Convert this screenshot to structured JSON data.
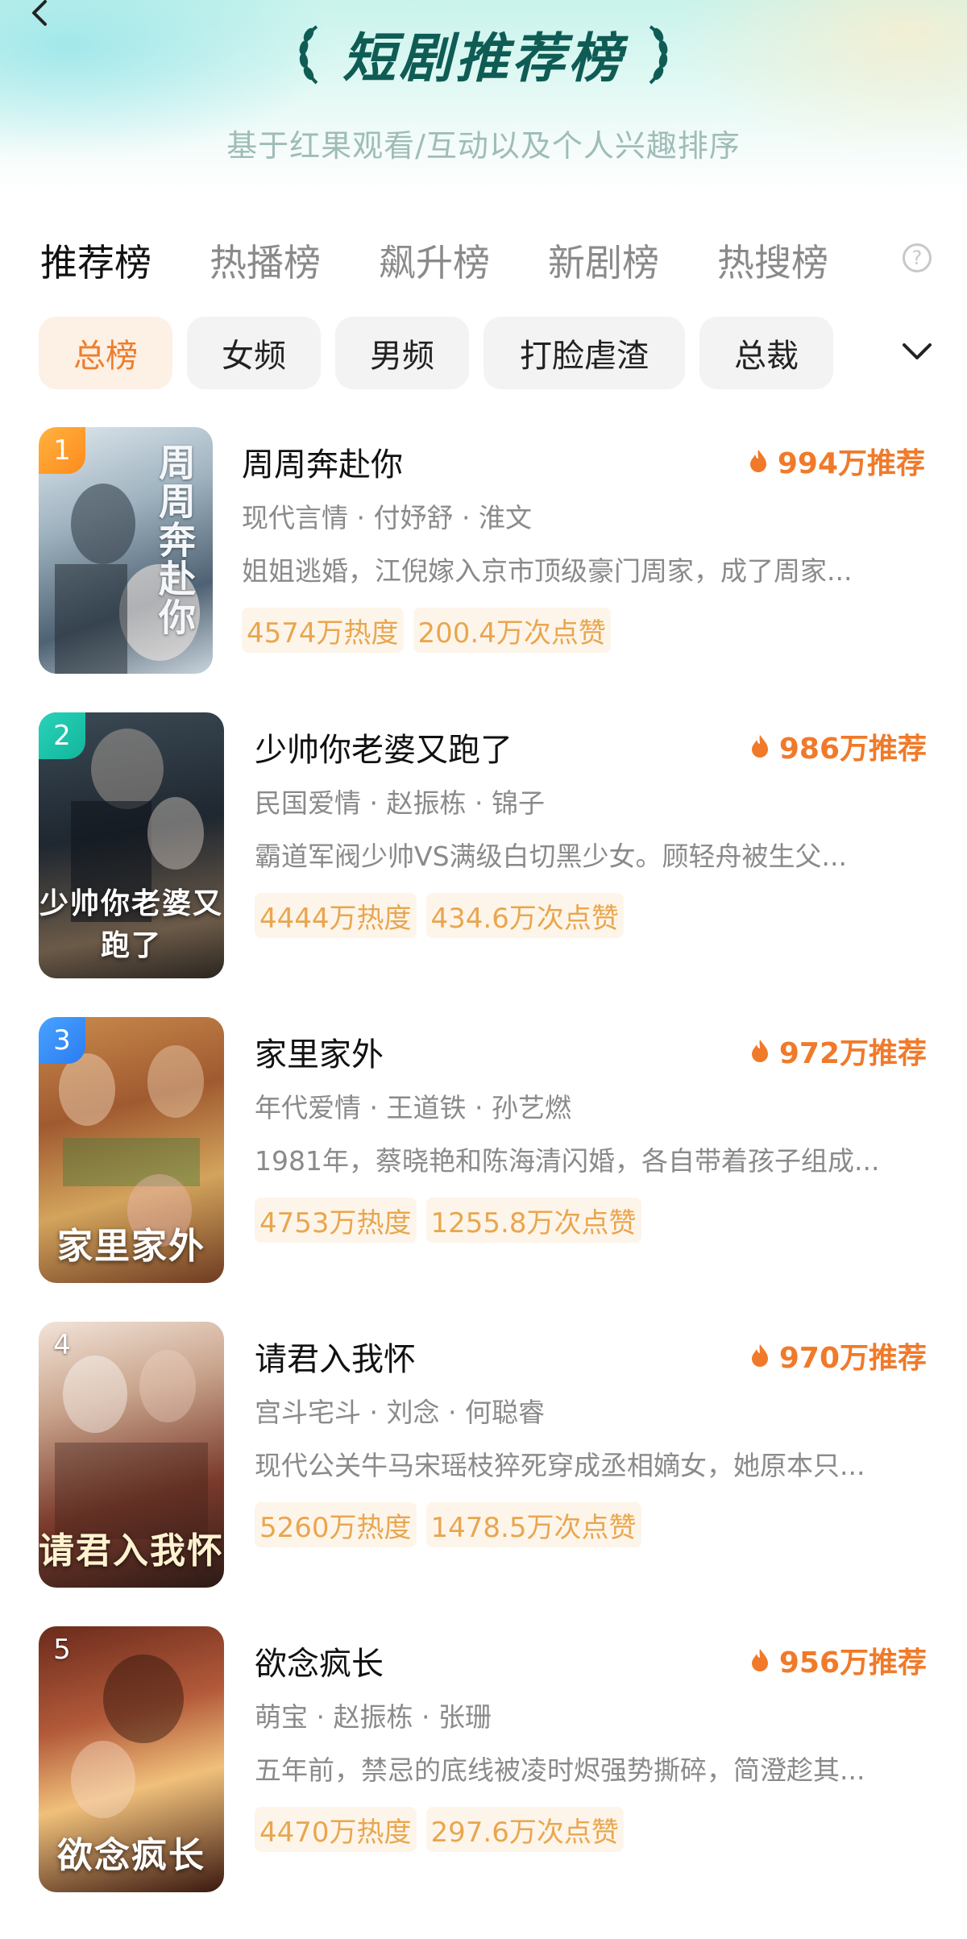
{
  "header": {
    "title": "短剧推荐榜",
    "subtitle": "基于红果观看/互动以及个人兴趣排序"
  },
  "tabs": [
    "推荐榜",
    "热播榜",
    "飙升榜",
    "新剧榜",
    "热搜榜"
  ],
  "help_label": "?",
  "chips": [
    "总榜",
    "女频",
    "男频",
    "打脸虐渣",
    "总裁"
  ],
  "colors": {
    "accent": "#ef7d2c",
    "title": "#0f5c55",
    "badge_text": "#e9a64f"
  },
  "items": [
    {
      "rank": "1",
      "title": "周周奔赴你",
      "recommend": "994万推荐",
      "meta": "现代言情 · 付妤舒 · 淮文",
      "desc": "姐姐逃婚，江倪嫁入京市顶级豪门周家，成了周家...",
      "heat": "4574万热度",
      "likes": "200.4万次点赞",
      "poster_text": "周周奔赴你"
    },
    {
      "rank": "2",
      "title": "少帅你老婆又跑了",
      "recommend": "986万推荐",
      "meta": "民国爱情 · 赵振栋 · 锦子",
      "desc": "霸道军阀少帅VS满级白切黑少女。顾轻舟被生父...",
      "heat": "4444万热度",
      "likes": "434.6万次点赞",
      "poster_text": "少帅你老婆又跑了"
    },
    {
      "rank": "3",
      "title": "家里家外",
      "recommend": "972万推荐",
      "meta": "年代爱情 · 王道铁 · 孙艺燃",
      "desc": "1981年，蔡晓艳和陈海清闪婚，各自带着孩子组成...",
      "heat": "4753万热度",
      "likes": "1255.8万次点赞",
      "poster_text": "家里家外"
    },
    {
      "rank": "4",
      "title": "请君入我怀",
      "recommend": "970万推荐",
      "meta": "宫斗宅斗 · 刘念 · 何聪睿",
      "desc": "现代公关牛马宋瑶枝猝死穿成丞相嫡女，她原本只...",
      "heat": "5260万热度",
      "likes": "1478.5万次点赞",
      "poster_text": "请君入我怀"
    },
    {
      "rank": "5",
      "title": "欲念疯长",
      "recommend": "956万推荐",
      "meta": "萌宝 · 赵振栋 · 张珊",
      "desc": "五年前，禁忌的底线被凌时烬强势撕碎，简澄趁其...",
      "heat": "4470万热度",
      "likes": "297.6万次点赞",
      "poster_text": "欲念疯长"
    }
  ]
}
